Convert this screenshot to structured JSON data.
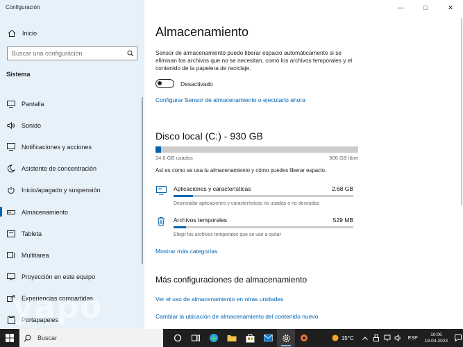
{
  "window": {
    "title": "Configuración",
    "controls": {
      "minimize": "—",
      "maximize": "□",
      "close": "✕"
    }
  },
  "sidebar": {
    "home_label": "Inicio",
    "search_placeholder": "Buscar una configuración",
    "section_title": "Sistema",
    "items": [
      {
        "label": "Pantalla",
        "icon": "monitor-icon",
        "active": false
      },
      {
        "label": "Sonido",
        "icon": "speaker-icon",
        "active": false
      },
      {
        "label": "Notificaciones y acciones",
        "icon": "notification-icon",
        "active": false
      },
      {
        "label": "Asistente de concentración",
        "icon": "moon-icon",
        "active": false
      },
      {
        "label": "Inicio/apagado y suspensión",
        "icon": "power-icon",
        "active": false
      },
      {
        "label": "Almacenamiento",
        "icon": "storage-icon",
        "active": true
      },
      {
        "label": "Tableta",
        "icon": "tablet-icon",
        "active": false
      },
      {
        "label": "Multitarea",
        "icon": "multitask-icon",
        "active": false
      },
      {
        "label": "Proyección en este equipo",
        "icon": "projection-icon",
        "active": false
      },
      {
        "label": "Experiencias compartidas",
        "icon": "share-icon",
        "active": false
      },
      {
        "label": "Portapapeles",
        "icon": "clipboard-icon",
        "active": false
      }
    ],
    "watermark": "yapo"
  },
  "main": {
    "title": "Almacenamiento",
    "description": "Sensor de almacenamiento puede liberar espacio automáticamente si se eliminan los archivos que no se necesitan, como los archivos temporales y el contenido de la papelera de reciclaje.",
    "toggle_state_label": "Desactivado",
    "toggle_on": false,
    "configure_link": "Configurar Sensor de almacenamiento o ejecutarlo ahora",
    "disk": {
      "title": "Disco local (C:) - 930 GB",
      "used_label": "24.6 GB usados",
      "free_label": "906 GB libre",
      "used_fraction": 0.027,
      "info": "Así es como se usa tu almacenamiento y cómo puedes liberar espacio."
    },
    "categories": [
      {
        "name": "Aplicaciones y características",
        "size": "2.68 GB",
        "sub": "Desinstalar aplicaciones y características no usadas o no deseadas",
        "fraction": 0.11,
        "icon": "apps-icon"
      },
      {
        "name": "Archivos temporales",
        "size": "529 MB",
        "sub": "Elegir los archivos temporales que se van a quitar",
        "fraction": 0.07,
        "icon": "trash-icon"
      }
    ],
    "more_categories_link": "Mostrar más categorías",
    "more_settings_title": "Más configuraciones de almacenamiento",
    "other_drives_link": "Ver el uso de almacenamiento en otras unidades",
    "change_location_link": "Cambiar la ubicación de almacenamiento del contenido nuevo"
  },
  "taskbar": {
    "search_label": "Buscar",
    "weather": "15°C",
    "language": "ESP",
    "time": "10:06",
    "date": "19-04-2023"
  },
  "colors": {
    "accent": "#0063b1",
    "sidebar_bg": "#e6f1fa",
    "taskbar_bg": "#1f1f1f"
  }
}
